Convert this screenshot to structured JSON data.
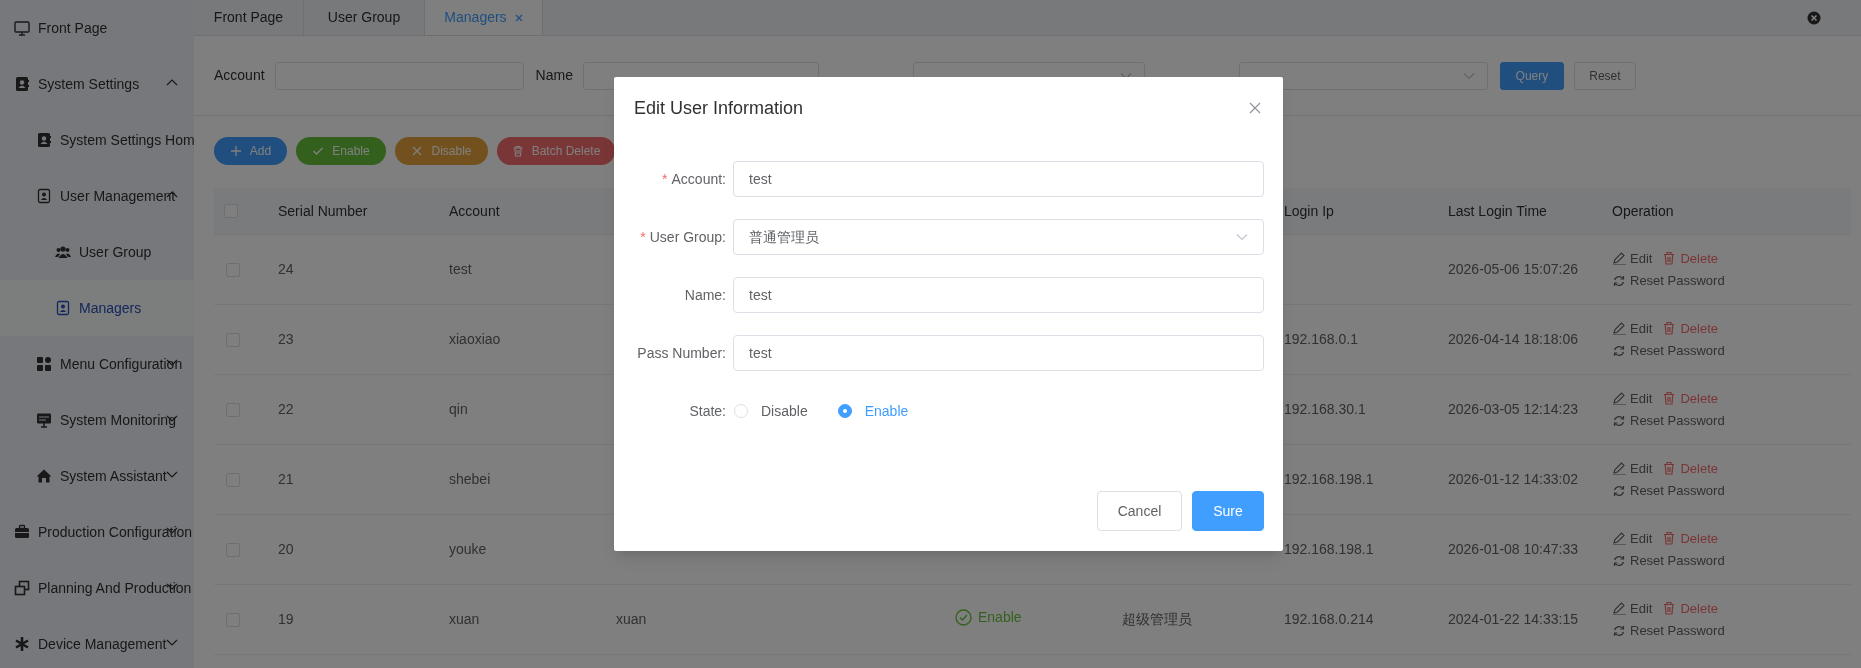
{
  "sidebar": {
    "items": [
      {
        "label": "Front Page",
        "selected": false
      },
      {
        "label": "System Settings",
        "selected": false,
        "expanded": true,
        "children": [
          {
            "label": "System Settings Hom",
            "selected": false
          },
          {
            "label": "User Management",
            "selected": false,
            "expanded": true,
            "children": [
              {
                "label": "User Group",
                "selected": false
              },
              {
                "label": "Managers",
                "selected": true
              }
            ]
          },
          {
            "label": "Menu Configuration",
            "selected": false,
            "expanded": false
          },
          {
            "label": "System Monitoring",
            "selected": false,
            "expanded": false
          },
          {
            "label": "System Assistant",
            "selected": false,
            "expanded": false
          }
        ]
      },
      {
        "label": "Production Configuration",
        "selected": false,
        "expanded": false
      },
      {
        "label": "Planning And Production",
        "selected": false,
        "expanded": false
      },
      {
        "label": "Device Management",
        "selected": false,
        "expanded": false
      }
    ]
  },
  "tabs": [
    {
      "label": "Front Page",
      "selected": false
    },
    {
      "label": "User Group",
      "selected": false
    },
    {
      "label": "Managers",
      "selected": true
    }
  ],
  "filters": [
    {
      "kind": "input",
      "label": "Account"
    },
    {
      "kind": "input",
      "label": "Name"
    },
    {
      "kind": "select"
    },
    {
      "kind": "select"
    }
  ],
  "filter_buttons": [
    {
      "label": "Query",
      "kind": "primary"
    },
    {
      "label": "Reset",
      "kind": "plain"
    }
  ],
  "toolbar": [
    {
      "label": "Add",
      "kind": "add"
    },
    {
      "label": "Enable",
      "kind": "enable"
    },
    {
      "label": "Disable",
      "kind": "disable"
    },
    {
      "label": "Batch Delete",
      "kind": "delete"
    }
  ],
  "table": {
    "header_checked": false,
    "columns": [
      "Serial Number",
      "Account",
      "Login Ip",
      "Last Login Time",
      "Operation"
    ],
    "rows": [
      {
        "checked": false,
        "serial": "24",
        "account": "test",
        "last_login": "2026-05-06 15:07:26",
        "actions": [
          "Edit",
          "Delete",
          "Reset Password"
        ]
      },
      {
        "checked": false,
        "serial": "23",
        "account": "xiaoxiao",
        "login_ip": "192.168.0.1",
        "last_login": "2026-04-14 18:18:06",
        "actions": [
          "Edit",
          "Delete",
          "Reset Password"
        ]
      },
      {
        "checked": false,
        "serial": "22",
        "account": "qin",
        "login_ip": "192.168.30.1",
        "last_login": "2026-03-05 12:14:23",
        "actions": [
          "Edit",
          "Delete",
          "Reset Password"
        ]
      },
      {
        "checked": false,
        "serial": "21",
        "account": "shebei",
        "login_ip": "192.168.198.1",
        "last_login": "2026-01-12 14:33:02",
        "actions": [
          "Edit",
          "Delete",
          "Reset Password"
        ]
      },
      {
        "checked": false,
        "serial": "20",
        "account": "youke",
        "login_ip": "192.168.198.1",
        "last_login": "2026-01-08 10:47:33",
        "actions": [
          "Edit",
          "Delete",
          "Reset Password"
        ]
      },
      {
        "checked": false,
        "serial": "19",
        "account": "xuan",
        "name": "xuan",
        "state": {
          "text": "Enable",
          "enabled": true
        },
        "group": "超级管理员",
        "login_ip": "192.168.0.214",
        "last_login": "2024-01-22 14:33:15",
        "actions": [
          "Edit",
          "Delete",
          "Reset Password"
        ]
      }
    ]
  },
  "dialog": {
    "title": "Edit User Information",
    "fields": [
      {
        "kind": "input",
        "required_mark": "*",
        "label": "Account:",
        "value": "test"
      },
      {
        "kind": "select",
        "required_mark": "*",
        "label": "User Group:",
        "value": "普通管理员"
      },
      {
        "kind": "input",
        "label": "Name:",
        "value": "test"
      },
      {
        "kind": "input",
        "label": "Pass Number:",
        "value": "test"
      },
      {
        "kind": "radio",
        "label": "State:",
        "options": [
          {
            "label": "Disable",
            "selected": false
          },
          {
            "label": "Enable",
            "selected": true
          }
        ]
      }
    ],
    "buttons": [
      {
        "label": "Cancel",
        "kind": "plain"
      },
      {
        "label": "Sure",
        "kind": "primary"
      }
    ]
  }
}
